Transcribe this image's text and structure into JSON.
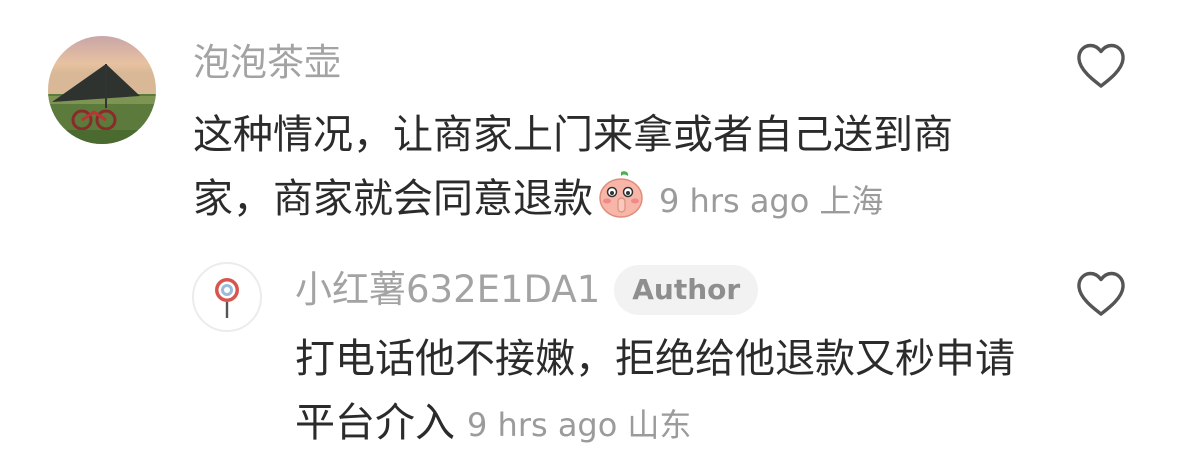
{
  "comment": {
    "username": "泡泡茶壶",
    "text": "这种情况，让商家上门来拿或者自己送到商家，商家就会同意退款",
    "time": "9 hrs ago",
    "location": "上海",
    "emoji": "shushing-peach-emoji"
  },
  "reply": {
    "username": "小红薯632E1DA1",
    "author_tag": "Author",
    "text": "打电话他不接嫩，拒绝给他退款又秒申请平台介入",
    "time": "9 hrs ago",
    "location": "山东"
  },
  "colors": {
    "username": "#a3a3a3",
    "body_text": "#2b2b2b",
    "meta": "#9b9b9b",
    "tag_bg": "#f2f2f2",
    "icon": "#555555"
  }
}
